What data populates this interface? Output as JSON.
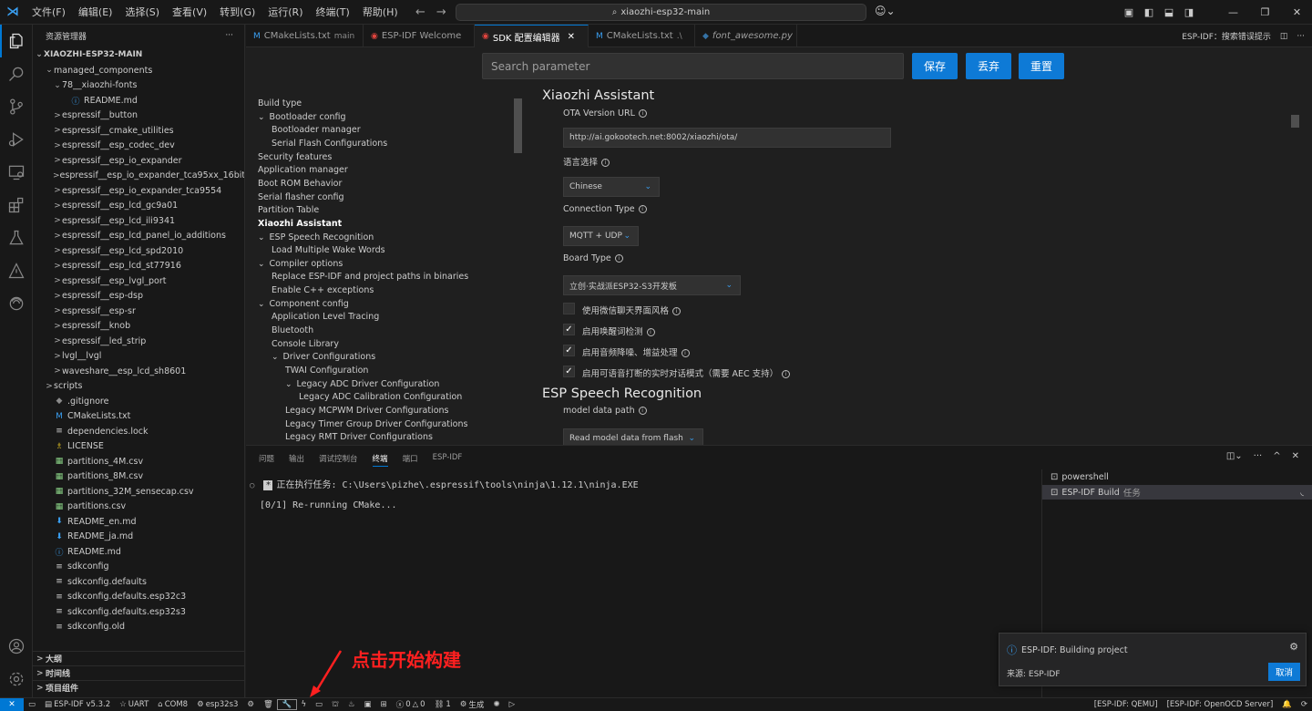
{
  "menu": [
    "文件(F)",
    "编辑(E)",
    "选择(S)",
    "查看(V)",
    "转到(G)",
    "运行(R)",
    "终端(T)",
    "帮助(H)"
  ],
  "search_box": "xiaozhi-esp32-main",
  "sidebar": {
    "title": "资源管理器",
    "root": "XIAOZHI-ESP32-MAIN",
    "tree": [
      {
        "label": "managed_components",
        "level": 1,
        "chev": "⌄",
        "icon": ""
      },
      {
        "label": "78__xiaozhi-fonts",
        "level": 2,
        "chev": "⌄",
        "icon": ""
      },
      {
        "label": "README.md",
        "level": 3,
        "chev": "",
        "icon": "ⓘ",
        "color": "#3aa0f3"
      },
      {
        "label": "espressif__button",
        "level": 2,
        "chev": ">",
        "icon": ""
      },
      {
        "label": "espressif__cmake_utilities",
        "level": 2,
        "chev": ">",
        "icon": ""
      },
      {
        "label": "espressif__esp_codec_dev",
        "level": 2,
        "chev": ">",
        "icon": ""
      },
      {
        "label": "espressif__esp_io_expander",
        "level": 2,
        "chev": ">",
        "icon": ""
      },
      {
        "label": "espressif__esp_io_expander_tca95xx_16bit",
        "level": 2,
        "chev": ">",
        "icon": ""
      },
      {
        "label": "espressif__esp_io_expander_tca9554",
        "level": 2,
        "chev": ">",
        "icon": ""
      },
      {
        "label": "espressif__esp_lcd_gc9a01",
        "level": 2,
        "chev": ">",
        "icon": ""
      },
      {
        "label": "espressif__esp_lcd_ili9341",
        "level": 2,
        "chev": ">",
        "icon": ""
      },
      {
        "label": "espressif__esp_lcd_panel_io_additions",
        "level": 2,
        "chev": ">",
        "icon": ""
      },
      {
        "label": "espressif__esp_lcd_spd2010",
        "level": 2,
        "chev": ">",
        "icon": ""
      },
      {
        "label": "espressif__esp_lcd_st77916",
        "level": 2,
        "chev": ">",
        "icon": ""
      },
      {
        "label": "espressif__esp_lvgl_port",
        "level": 2,
        "chev": ">",
        "icon": ""
      },
      {
        "label": "espressif__esp-dsp",
        "level": 2,
        "chev": ">",
        "icon": ""
      },
      {
        "label": "espressif__esp-sr",
        "level": 2,
        "chev": ">",
        "icon": ""
      },
      {
        "label": "espressif__knob",
        "level": 2,
        "chev": ">",
        "icon": ""
      },
      {
        "label": "espressif__led_strip",
        "level": 2,
        "chev": ">",
        "icon": ""
      },
      {
        "label": "lvgl__lvgl",
        "level": 2,
        "chev": ">",
        "icon": ""
      },
      {
        "label": "waveshare__esp_lcd_sh8601",
        "level": 2,
        "chev": ">",
        "icon": ""
      },
      {
        "label": "scripts",
        "level": 1,
        "chev": ">",
        "icon": ""
      },
      {
        "label": ".gitignore",
        "level": 1,
        "chev": "",
        "icon": "◆",
        "color": "#8b8b8b"
      },
      {
        "label": "CMakeLists.txt",
        "level": 1,
        "chev": "",
        "icon": "M",
        "color": "#3aa0f3"
      },
      {
        "label": "dependencies.lock",
        "level": 1,
        "chev": "",
        "icon": "≡",
        "color": "#cccccc"
      },
      {
        "label": "LICENSE",
        "level": 1,
        "chev": "",
        "icon": "♗",
        "color": "#d7ba22"
      },
      {
        "label": "partitions_4M.csv",
        "level": 1,
        "chev": "",
        "icon": "▦",
        "color": "#89d185"
      },
      {
        "label": "partitions_8M.csv",
        "level": 1,
        "chev": "",
        "icon": "▦",
        "color": "#89d185"
      },
      {
        "label": "partitions_32M_sensecap.csv",
        "level": 1,
        "chev": "",
        "icon": "▦",
        "color": "#89d185"
      },
      {
        "label": "partitions.csv",
        "level": 1,
        "chev": "",
        "icon": "▦",
        "color": "#89d185"
      },
      {
        "label": "README_en.md",
        "level": 1,
        "chev": "",
        "icon": "⬇",
        "color": "#3aa0f3"
      },
      {
        "label": "README_ja.md",
        "level": 1,
        "chev": "",
        "icon": "⬇",
        "color": "#3aa0f3"
      },
      {
        "label": "README.md",
        "level": 1,
        "chev": "",
        "icon": "ⓘ",
        "color": "#3aa0f3"
      },
      {
        "label": "sdkconfig",
        "level": 1,
        "chev": "",
        "icon": "≡",
        "color": "#cccccc"
      },
      {
        "label": "sdkconfig.defaults",
        "level": 1,
        "chev": "",
        "icon": "≡",
        "color": "#cccccc"
      },
      {
        "label": "sdkconfig.defaults.esp32c3",
        "level": 1,
        "chev": "",
        "icon": "≡",
        "color": "#cccccc"
      },
      {
        "label": "sdkconfig.defaults.esp32s3",
        "level": 1,
        "chev": "",
        "icon": "≡",
        "color": "#cccccc"
      },
      {
        "label": "sdkconfig.old",
        "level": 1,
        "chev": "",
        "icon": "≡",
        "color": "#cccccc"
      }
    ],
    "sections": [
      "大纲",
      "时间线",
      "项目组件"
    ]
  },
  "tabs": [
    {
      "label": "CMakeLists.txt",
      "desc": "main",
      "icon": "M",
      "icon_color": "#3aa0f3",
      "active": false,
      "italic": false,
      "close": false
    },
    {
      "label": "ESP-IDF Welcome",
      "desc": "",
      "icon": "◉",
      "icon_color": "#e0443e",
      "active": false,
      "italic": false,
      "close": false
    },
    {
      "label": "SDK 配置编辑器",
      "desc": "",
      "icon": "◉",
      "icon_color": "#e0443e",
      "active": true,
      "italic": false,
      "close": true
    },
    {
      "label": "CMakeLists.txt",
      "desc": ".\\",
      "icon": "M",
      "icon_color": "#3aa0f3",
      "active": false,
      "italic": false,
      "close": false
    },
    {
      "label": "font_awesome.py",
      "desc": "",
      "icon": "◆",
      "icon_color": "#3572a5",
      "active": false,
      "italic": true,
      "close": false
    }
  ],
  "tab_right": "ESP-IDF：搜索错误提示",
  "sdk": {
    "search_placeholder": "Search parameter",
    "save": "保存",
    "discard": "丢弃",
    "reset": "重置",
    "nav": [
      {
        "label": "Build type",
        "level": 0,
        "chev": "",
        "bold": false
      },
      {
        "label": "Bootloader config",
        "level": 0,
        "chev": "⌄",
        "bold": false
      },
      {
        "label": "Bootloader manager",
        "level": 1,
        "chev": "",
        "bold": false
      },
      {
        "label": "Serial Flash Configurations",
        "level": 1,
        "chev": "",
        "bold": false
      },
      {
        "label": "Security features",
        "level": 0,
        "chev": "",
        "bold": false
      },
      {
        "label": "Application manager",
        "level": 0,
        "chev": "",
        "bold": false
      },
      {
        "label": "Boot ROM Behavior",
        "level": 0,
        "chev": "",
        "bold": false
      },
      {
        "label": "Serial flasher config",
        "level": 0,
        "chev": "",
        "bold": false
      },
      {
        "label": "Partition Table",
        "level": 0,
        "chev": "",
        "bold": false
      },
      {
        "label": "Xiaozhi Assistant",
        "level": 0,
        "chev": "",
        "bold": true
      },
      {
        "label": "ESP Speech Recognition",
        "level": 0,
        "chev": "⌄",
        "bold": false
      },
      {
        "label": "Load Multiple Wake Words",
        "level": 1,
        "chev": "",
        "bold": false
      },
      {
        "label": "Compiler options",
        "level": 0,
        "chev": "⌄",
        "bold": false
      },
      {
        "label": "Replace ESP-IDF and project paths in binaries",
        "level": 1,
        "chev": "",
        "bold": false
      },
      {
        "label": "Enable C++ exceptions",
        "level": 1,
        "chev": "",
        "bold": false
      },
      {
        "label": "Component config",
        "level": 0,
        "chev": "⌄",
        "bold": false
      },
      {
        "label": "Application Level Tracing",
        "level": 1,
        "chev": "",
        "bold": false
      },
      {
        "label": "Bluetooth",
        "level": 1,
        "chev": "",
        "bold": false
      },
      {
        "label": "Console Library",
        "level": 1,
        "chev": "",
        "bold": false
      },
      {
        "label": "Driver Configurations",
        "level": 1,
        "chev": "⌄",
        "bold": false
      },
      {
        "label": "TWAI Configuration",
        "level": 2,
        "chev": "",
        "bold": false
      },
      {
        "label": "Legacy ADC Driver Configuration",
        "level": 2,
        "chev": "⌄",
        "bold": false
      },
      {
        "label": "Legacy ADC Calibration Configuration",
        "level": 3,
        "chev": "",
        "bold": false
      },
      {
        "label": "Legacy MCPWM Driver Configurations",
        "level": 2,
        "chev": "",
        "bold": false
      },
      {
        "label": "Legacy Timer Group Driver Configurations",
        "level": 2,
        "chev": "",
        "bold": false
      },
      {
        "label": "Legacy RMT Driver Configurations",
        "level": 2,
        "chev": "",
        "bold": false
      }
    ],
    "section1": "Xiaozhi Assistant",
    "ota_label": "OTA Version URL",
    "ota_value": "http://ai.gokootech.net:8002/xiaozhi/ota/",
    "lang_label": "语言选择",
    "lang_value": "Chinese",
    "conn_label": "Connection Type",
    "conn_value": "MQTT + UDP",
    "board_label": "Board Type",
    "board_value": "立创·实战派ESP32-S3开发板",
    "checks": [
      {
        "label": "使用微信聊天界面风格",
        "checked": false
      },
      {
        "label": "启用唤醒词检测",
        "checked": true
      },
      {
        "label": "启用音频降噪、增益处理",
        "checked": true
      },
      {
        "label": "启用可语音打断的实时对话模式（需要 AEC 支持）",
        "checked": true
      }
    ],
    "section2": "ESP Speech Recognition",
    "model_label": "model data path",
    "model_value": "Read model data from flash"
  },
  "panel": {
    "tabs": [
      "问题",
      "输出",
      "调试控制台",
      "终端",
      "端口",
      "ESP-IDF"
    ],
    "active_tab": "终端",
    "term_task": "正在执行任务: C:\\Users\\pizhe\\.espressif\\tools\\ninja\\1.12.1\\ninja.EXE",
    "term_line2": "[0/1] Re-running CMake...",
    "terminals": [
      {
        "label": "powershell",
        "suffix": ""
      },
      {
        "label": "ESP-IDF Build",
        "suffix": "任务"
      }
    ]
  },
  "notification": {
    "title": "ESP-IDF: Building project",
    "source": "来源: ESP-IDF",
    "cancel": "取消"
  },
  "annotation": "点击开始构建",
  "status": {
    "idf": "ESP-IDF v5.3.2",
    "uart": "UART",
    "com": "COM8",
    "target": "esp32s3",
    "errors": "0",
    "warnings": "0",
    "ports": "1",
    "build": "生成",
    "qemu": "[ESP-IDF: QEMU]",
    "openocd": "[ESP-IDF: OpenOCD Server]"
  },
  "colors": {
    "accent": "#0078d4",
    "button": "#0e7ad6",
    "annotation": "#ff2020"
  }
}
